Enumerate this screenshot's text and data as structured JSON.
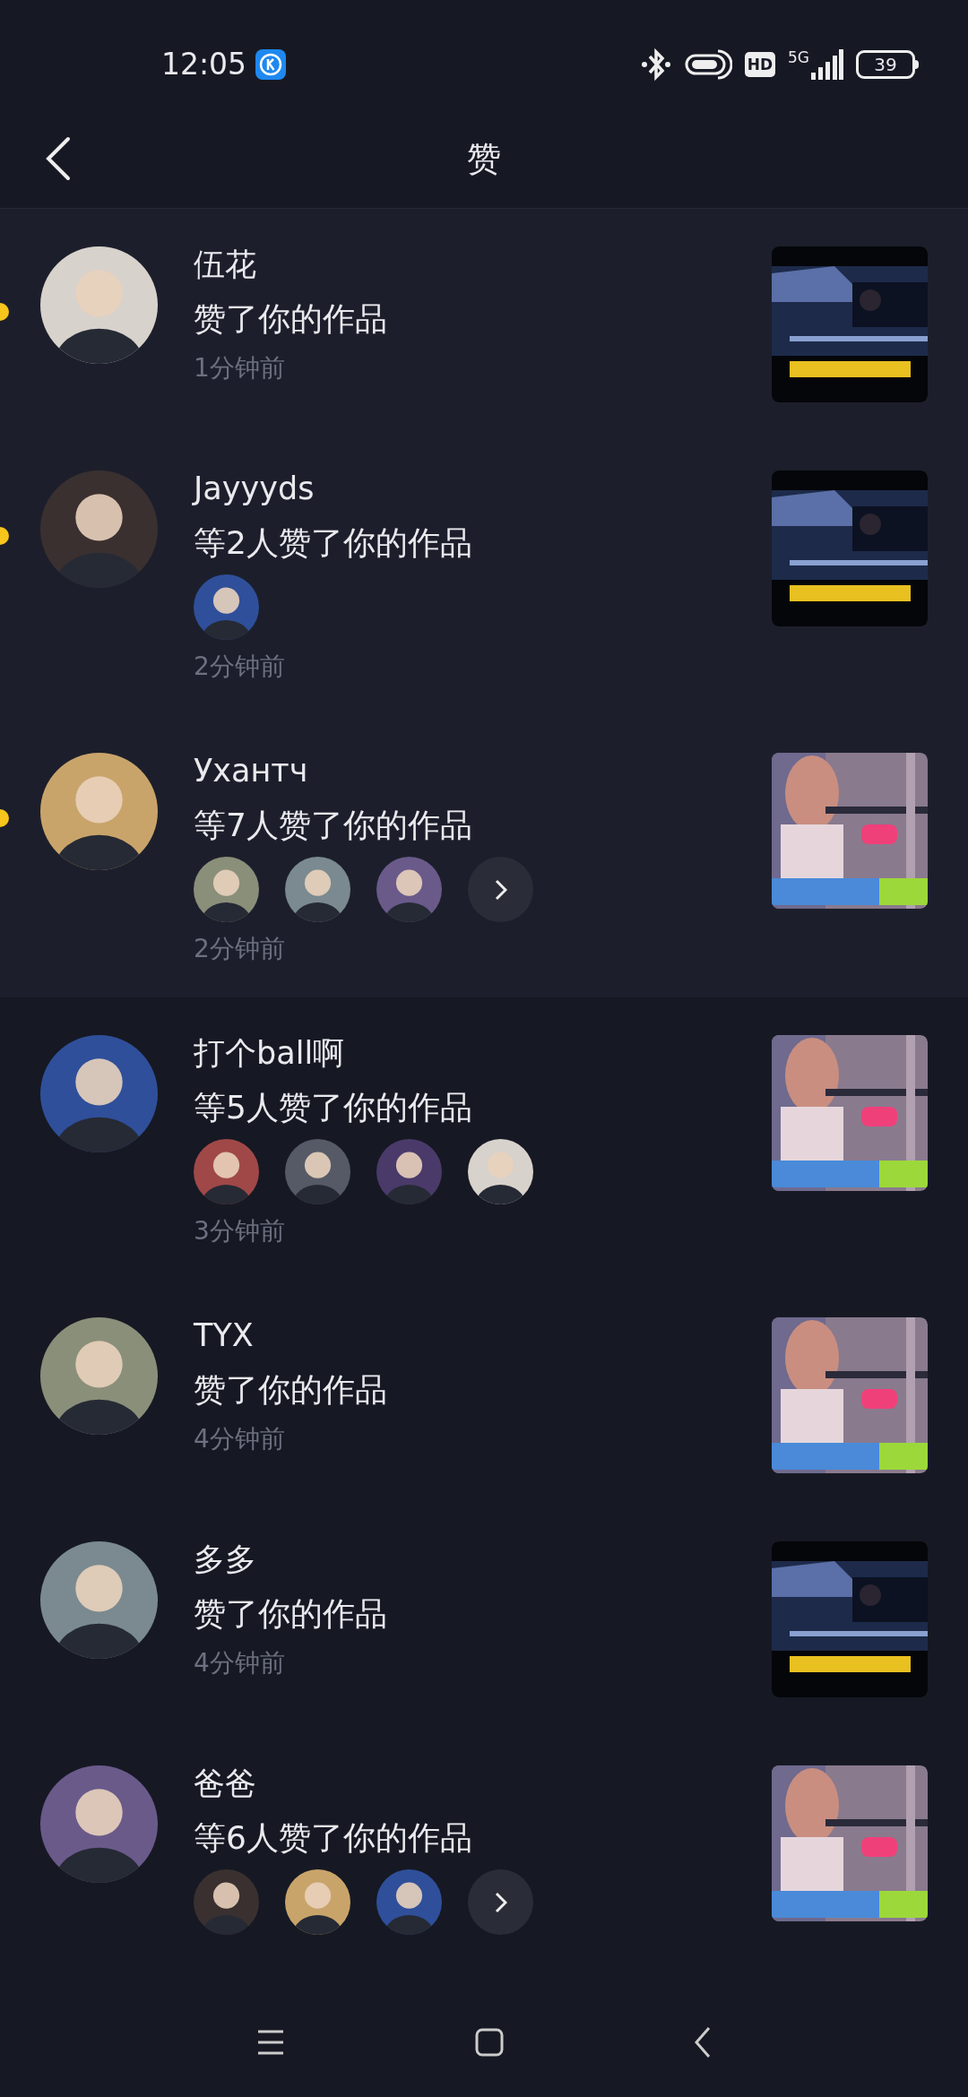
{
  "status_bar": {
    "time": "12:05",
    "hd": "HD",
    "network": "5G",
    "battery": "39"
  },
  "header": {
    "title": "赞"
  },
  "items": [
    {
      "name": "伍花",
      "action": "赞了你的作品",
      "time": "1分钟前",
      "unread": true,
      "more": false
    },
    {
      "name": "Jayyyds",
      "action": "等2人赞了你的作品",
      "time": "2分钟前",
      "unread": true,
      "more": false
    },
    {
      "name": "Ухантч",
      "action": "等7人赞了你的作品",
      "time": "2分钟前",
      "unread": true,
      "more": true
    },
    {
      "name": "打个ball啊",
      "action": "等5人赞了你的作品",
      "time": "3分钟前",
      "unread": false,
      "more": false
    },
    {
      "name": "TYX",
      "action": "赞了你的作品",
      "time": "4分钟前",
      "unread": false,
      "more": false
    },
    {
      "name": "多多",
      "action": "赞了你的作品",
      "time": "4分钟前",
      "unread": false,
      "more": false
    },
    {
      "name": "爸爸",
      "action": "等6人赞了你的作品",
      "unread": false,
      "more": true
    }
  ]
}
